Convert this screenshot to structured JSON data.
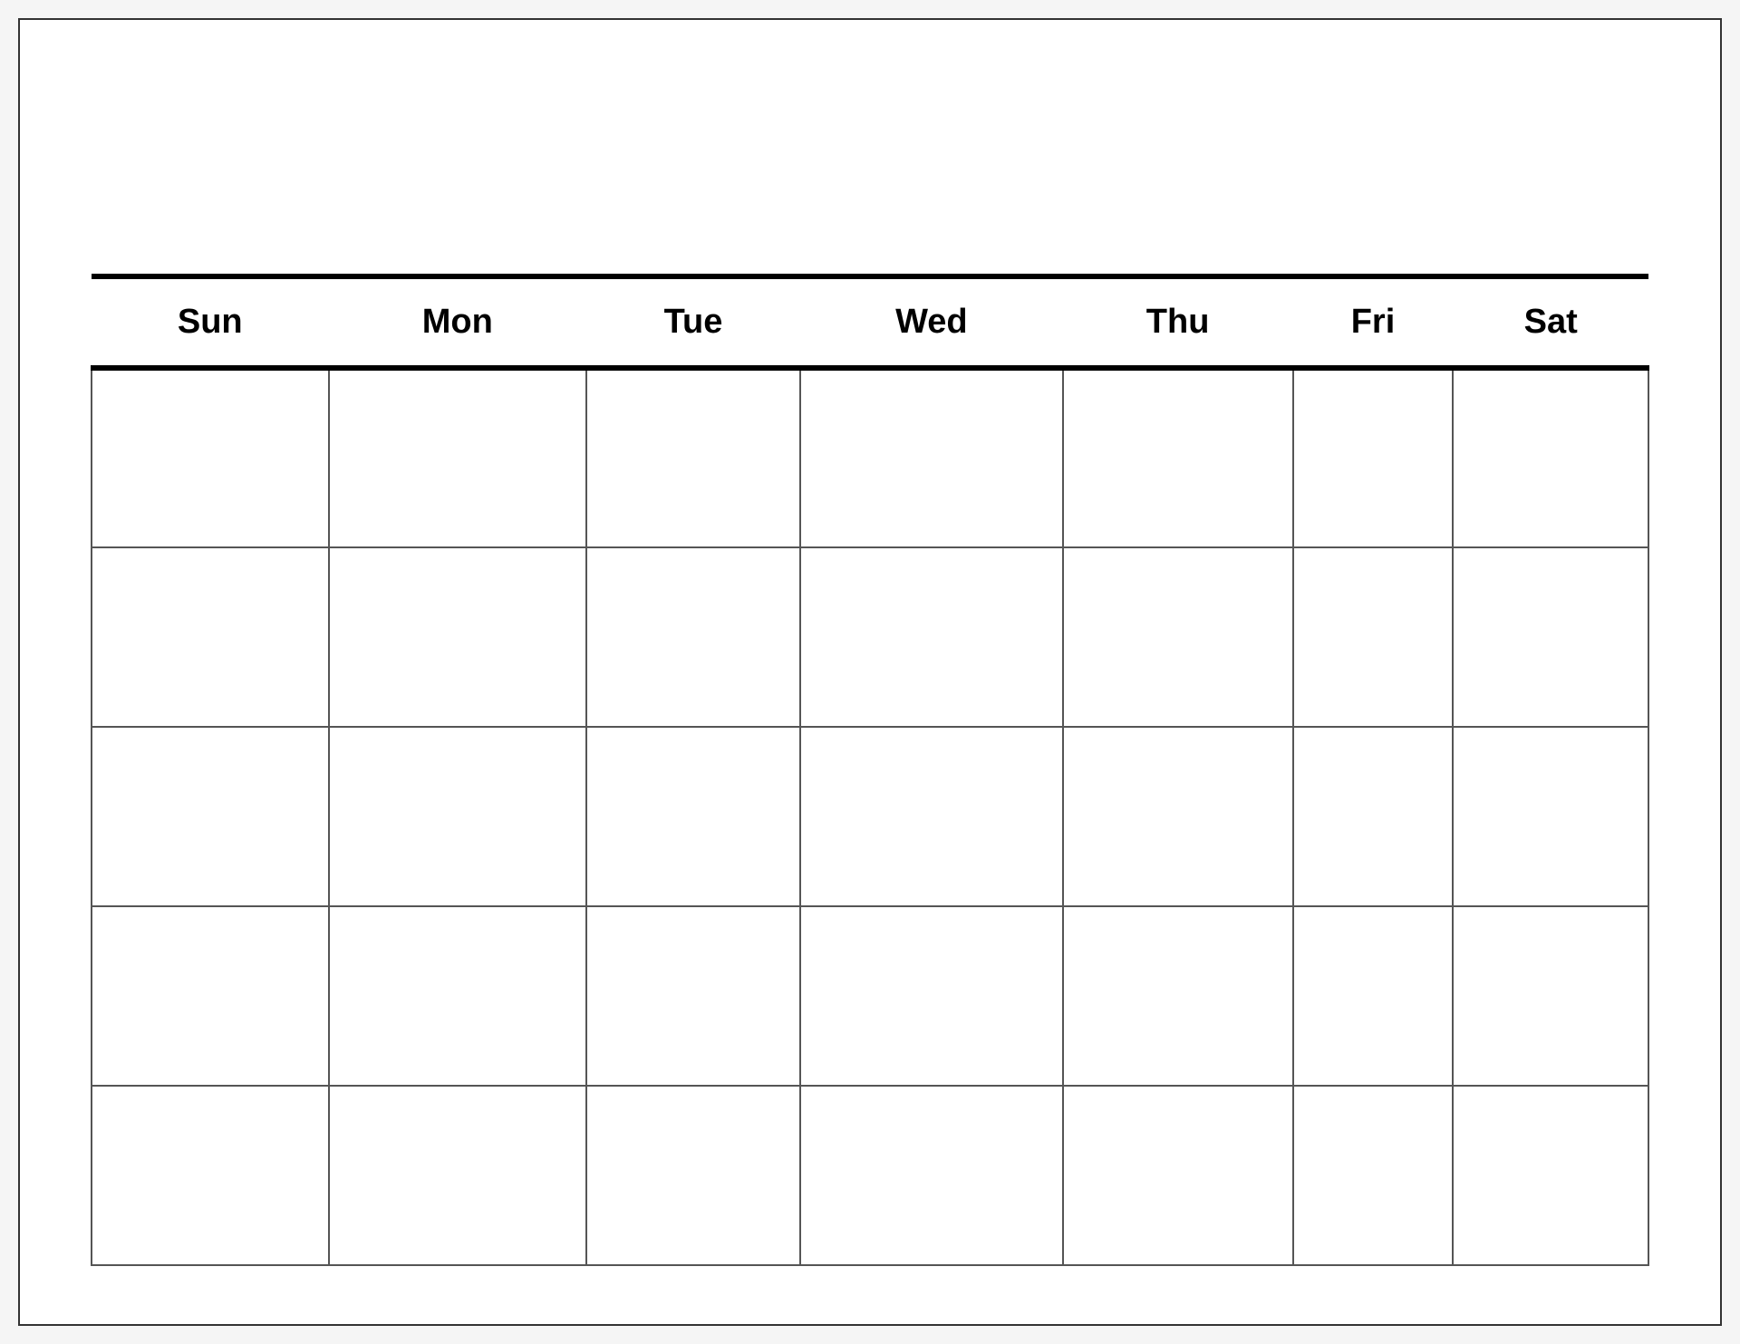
{
  "calendar": {
    "day_headers": [
      "Sun",
      "Mon",
      "Tue",
      "Wed",
      "Thu",
      "Fri",
      "Sat"
    ],
    "num_weeks": 5
  }
}
